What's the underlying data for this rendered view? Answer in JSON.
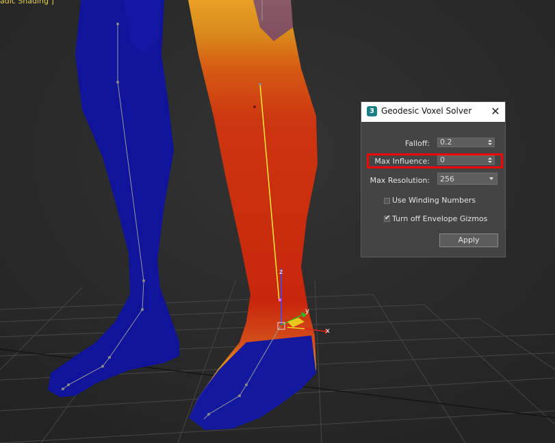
{
  "viewport": {
    "shading_label": "adic Shading ]",
    "gizmo": {
      "x_label": "x",
      "y_label": "y",
      "z_label": "z"
    }
  },
  "dialog": {
    "app_icon_text": "3",
    "title": "Geodesic Voxel Solver",
    "close_icon": "close-icon",
    "falloff": {
      "label": "Falloff:",
      "value": "0.2"
    },
    "max_influence": {
      "label": "Max Influence:",
      "value": "0"
    },
    "max_resolution": {
      "label": "Max Resolution:",
      "value": "256"
    },
    "use_winding_numbers": {
      "label": "Use Winding Numbers",
      "checked": false
    },
    "turn_off_envelope_gizmos": {
      "label": "Turn off Envelope Gizmos",
      "checked": true,
      "mark": "✔"
    },
    "apply_label": "Apply",
    "highlight_color": "#ff0000"
  }
}
